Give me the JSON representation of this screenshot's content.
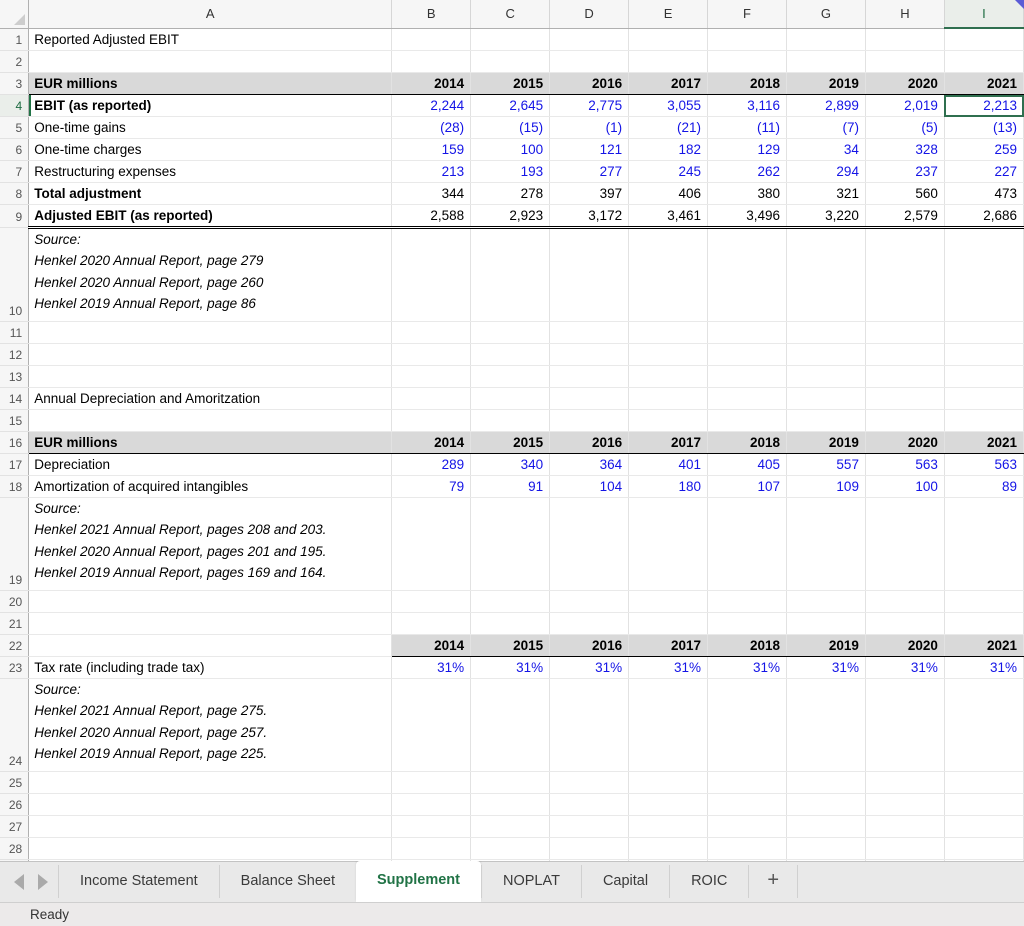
{
  "columns": [
    "A",
    "B",
    "C",
    "D",
    "E",
    "F",
    "G",
    "H",
    "I"
  ],
  "selection": {
    "cell": "I4",
    "column": "I",
    "row": 4
  },
  "sheet": {
    "title_row1": "Reported Adjusted EBIT",
    "section2_title": "Annual Depreciation and Amoritzation",
    "ebit_table": {
      "header_label": "EUR millions",
      "years": [
        "2014",
        "2015",
        "2016",
        "2017",
        "2018",
        "2019",
        "2020",
        "2021"
      ],
      "rows": [
        {
          "label": "EBIT (as reported)",
          "values": [
            "2,244",
            "2,645",
            "2,775",
            "3,055",
            "3,116",
            "2,899",
            "2,019",
            "2,213"
          ]
        },
        {
          "label": "One-time gains",
          "values": [
            "(28)",
            "(15)",
            "(1)",
            "(21)",
            "(11)",
            "(7)",
            "(5)",
            "(13)"
          ]
        },
        {
          "label": "One-time charges",
          "values": [
            "159",
            "100",
            "121",
            "182",
            "129",
            "34",
            "328",
            "259"
          ]
        },
        {
          "label": "Restructuring expenses",
          "values": [
            "213",
            "193",
            "277",
            "245",
            "262",
            "294",
            "237",
            "227"
          ]
        },
        {
          "label": "Total adjustment",
          "values": [
            "344",
            "278",
            "397",
            "406",
            "380",
            "321",
            "560",
            "473"
          ]
        },
        {
          "label": "Adjusted EBIT (as reported)",
          "values": [
            "2,588",
            "2,923",
            "3,172",
            "3,461",
            "3,496",
            "3,220",
            "2,579",
            "2,686"
          ]
        }
      ]
    },
    "source1": [
      "Source:",
      "Henkel 2020 Annual Report, page 279",
      "Henkel 2020 Annual Report, page 260",
      "Henkel 2019 Annual Report, page 86"
    ],
    "da_table": {
      "header_label": "EUR millions",
      "years": [
        "2014",
        "2015",
        "2016",
        "2017",
        "2018",
        "2019",
        "2020",
        "2021"
      ],
      "rows": [
        {
          "label": "Depreciation",
          "values": [
            "289",
            "340",
            "364",
            "401",
            "405",
            "557",
            "563",
            "563"
          ]
        },
        {
          "label": "Amortization of acquired intangibles",
          "values": [
            "79",
            "91",
            "104",
            "180",
            "107",
            "109",
            "100",
            "89"
          ]
        }
      ]
    },
    "source2": [
      "Source:",
      "Henkel 2021 Annual Report, pages 208 and 203.",
      "Henkel 2020 Annual Report, pages 201 and 195.",
      "Henkel 2019 Annual Report, pages 169 and 164."
    ],
    "tax_table": {
      "header_label": "",
      "years": [
        "2014",
        "2015",
        "2016",
        "2017",
        "2018",
        "2019",
        "2020",
        "2021"
      ],
      "rows": [
        {
          "label": "Tax rate (including trade tax)",
          "values": [
            "31%",
            "31%",
            "31%",
            "31%",
            "31%",
            "31%",
            "31%",
            "31%"
          ]
        }
      ]
    },
    "source3": [
      "Source:",
      "Henkel 2021 Annual Report, page 275.",
      "Henkel 2020 Annual Report, page 257.",
      "Henkel 2019 Annual Report, page 225."
    ]
  },
  "tabbar": {
    "prev_icon": "triangle-left-icon",
    "next_icon": "triangle-right-icon",
    "tabs": [
      {
        "label": "Income Statement",
        "active": false
      },
      {
        "label": "Balance Sheet",
        "active": false
      },
      {
        "label": "Supplement",
        "active": true
      },
      {
        "label": "NOPLAT",
        "active": false
      },
      {
        "label": "Capital",
        "active": false
      },
      {
        "label": "ROIC",
        "active": false
      }
    ],
    "add_sheet_label": "+"
  },
  "statusbar": {
    "text": "Ready"
  },
  "colors": {
    "accent_green": "#217346",
    "value_blue": "#1414e6",
    "header_fill": "#d9d9d9",
    "comment_marker": "#5b5bd6"
  }
}
